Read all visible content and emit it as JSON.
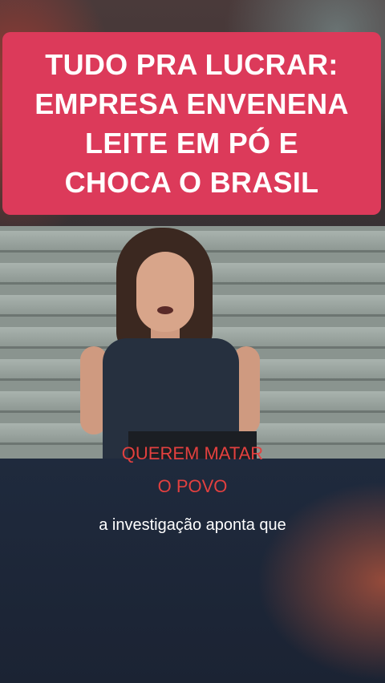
{
  "headline": {
    "lines": [
      "TUDO PRA LUCRAR:",
      "EMPRESA ENVENENA",
      "LEITE EM PÓ E",
      "CHOCA O BRASIL"
    ],
    "background": "#dc3a5a",
    "color": "#ffffff"
  },
  "overlay": {
    "line1": "QUEREM MATAR",
    "line2": "O POVO",
    "color": "#e3403f"
  },
  "subtitle": "a investigação aponta que"
}
